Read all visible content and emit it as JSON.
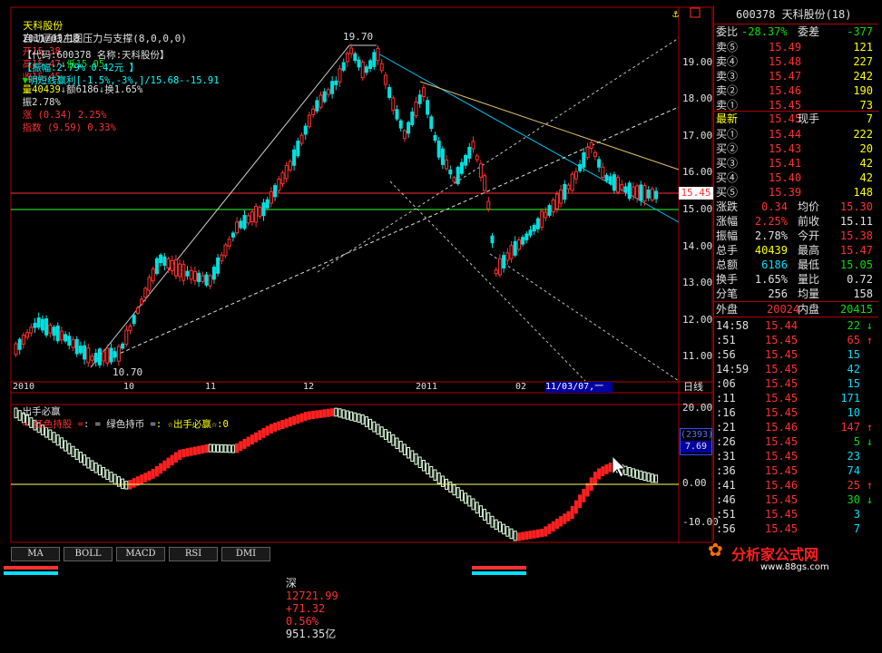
{
  "header": {
    "line1": {
      "name": "天科股份",
      "indicator": "自动画线主图压力与支撑(8,0,0,0)"
    },
    "line2": {
      "date": "2011/03/18",
      "open": "开15.38",
      "high": "高15.47",
      "low": "低15.05",
      "close": "收15.45",
      "volume": "量40439",
      "amount": "额6186",
      "turnover": "换1.65%",
      "amplitude": "振2.78%",
      "change": "涨 (0.34) 2.25%",
      "index": "指数 (9.59) 0.33%"
    },
    "line3": {
      "code": "【代码:600378 名称:天科股份】",
      "amp": "【振幅:2.79% 0.42元 】",
      "tri": "明短线赢利[-1.5%,-3%,]/15.68--15.91"
    }
  },
  "price_axis": [
    "19.00",
    "18.00",
    "17.00",
    "16.00",
    "15.00",
    "14.00",
    "13.00",
    "12.00",
    "11.00"
  ],
  "current_price_tag": "15.45",
  "annotations": {
    "high_label": "19.70",
    "low_label": "10.70"
  },
  "time_axis": {
    "labels": [
      "2010",
      "10",
      "11",
      "12",
      "2011",
      "02"
    ],
    "cursor_date": "11/03/07,一",
    "period": "日线"
  },
  "indicator": {
    "title": "出手必赢",
    "legend1": "= 红色持股 =",
    "legend2": ": = 绿色持币 =",
    "legend3": ": ☆出手必赢☆:0",
    "axis": [
      "20.00",
      "10.00",
      "0.00",
      "-10.00"
    ],
    "readout_top": "(2393)",
    "readout_val": "7.69"
  },
  "tabs": [
    "MA",
    "BOLL",
    "MACD",
    "RSI",
    "DMI"
  ],
  "status_bar": {
    "market": "深",
    "index": "12721.99",
    "change": "+71.32",
    "pct": "0.56%",
    "amount": "951.35亿"
  },
  "quote_panel": {
    "title": "600378  天科股份(18)",
    "weibi_label": "委比",
    "weibi_val": "-28.37%",
    "weicha_label": "委差",
    "weicha_val": "-377",
    "asks": [
      {
        "label": "卖⑤",
        "price": "15.49",
        "vol": "121"
      },
      {
        "label": "卖④",
        "price": "15.48",
        "vol": "227"
      },
      {
        "label": "卖③",
        "price": "15.47",
        "vol": "242"
      },
      {
        "label": "卖②",
        "price": "15.46",
        "vol": "190"
      },
      {
        "label": "卖①",
        "price": "15.45",
        "vol": "73"
      }
    ],
    "latest": {
      "label": "最新",
      "price": "15.45",
      "label2": "现手",
      "vol": "7"
    },
    "bids": [
      {
        "label": "买①",
        "price": "15.44",
        "vol": "222"
      },
      {
        "label": "买②",
        "price": "15.43",
        "vol": "20"
      },
      {
        "label": "买③",
        "price": "15.41",
        "vol": "42"
      },
      {
        "label": "买④",
        "price": "15.40",
        "vol": "42"
      },
      {
        "label": "买⑤",
        "price": "15.39",
        "vol": "148"
      }
    ],
    "stats": [
      {
        "l1": "涨跌",
        "v1": "0.34",
        "l2": "均价",
        "v2": "15.30"
      },
      {
        "l1": "涨幅",
        "v1": "2.25%",
        "l2": "前收",
        "v2": "15.11"
      },
      {
        "l1": "振幅",
        "v1": "2.78%",
        "l2": "今开",
        "v2": "15.38"
      },
      {
        "l1": "总手",
        "v1": "40439",
        "l2": "最高",
        "v2": "15.47"
      },
      {
        "l1": "总额",
        "v1": "6186",
        "l2": "最低",
        "v2": "15.05"
      },
      {
        "l1": "换手",
        "v1": "1.65%",
        "l2": "量比",
        "v2": "0.72"
      },
      {
        "l1": "分笔",
        "v1": "256",
        "l2": "均量",
        "v2": "158"
      }
    ],
    "outer_label": "外盘",
    "outer_val": "20024",
    "inner_label": "内盘",
    "inner_val": "20415",
    "ticks": [
      {
        "t": "14:58",
        "p": "15.44",
        "v": "22",
        "a": "↓"
      },
      {
        "t": ":51",
        "p": "15.45",
        "v": "65",
        "a": "↑"
      },
      {
        "t": ":56",
        "p": "15.45",
        "v": "15",
        "a": ""
      },
      {
        "t": "14:59",
        "p": "15.45",
        "v": "42",
        "a": ""
      },
      {
        "t": ":06",
        "p": "15.45",
        "v": "15",
        "a": ""
      },
      {
        "t": ":11",
        "p": "15.45",
        "v": "171",
        "a": ""
      },
      {
        "t": ":16",
        "p": "15.45",
        "v": "10",
        "a": ""
      },
      {
        "t": ":21",
        "p": "15.46",
        "v": "147",
        "a": "↑"
      },
      {
        "t": ":26",
        "p": "15.45",
        "v": "5",
        "a": "↓"
      },
      {
        "t": ":31",
        "p": "15.45",
        "v": "23",
        "a": ""
      },
      {
        "t": ":36",
        "p": "15.45",
        "v": "74",
        "a": ""
      },
      {
        "t": ":41",
        "p": "15.46",
        "v": "25",
        "a": "↑"
      },
      {
        "t": ":46",
        "p": "15.45",
        "v": "30",
        "a": "↓"
      },
      {
        "t": ":51",
        "p": "15.45",
        "v": "3",
        "a": ""
      },
      {
        "t": ":56",
        "p": "15.45",
        "v": "7",
        "a": ""
      }
    ]
  },
  "logo": {
    "text": "分析家公式网",
    "url": "www.88gs.com"
  },
  "colors": {
    "up": "#ff3030",
    "down": "#00e0e0",
    "bg": "#000000",
    "grid": "#b00000"
  }
}
